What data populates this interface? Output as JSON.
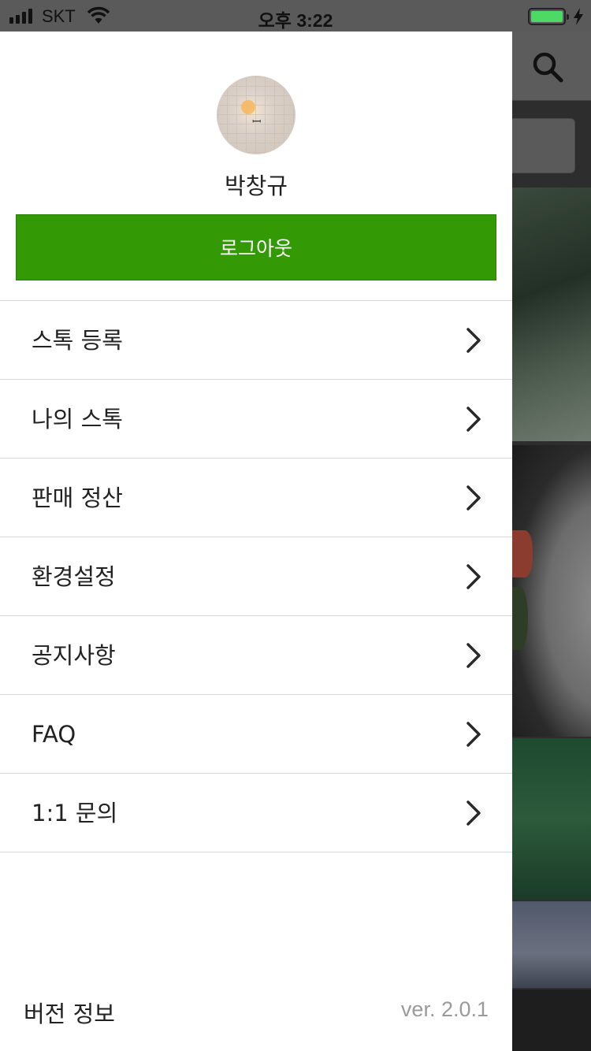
{
  "status_bar": {
    "carrier": "SKT",
    "time": "오후 3:22",
    "battery_level": 1.0,
    "signal_bars": 4,
    "icons": [
      "signal-icon",
      "wifi-icon",
      "battery-icon",
      "charging-bolt-icon"
    ]
  },
  "drawer": {
    "profile": {
      "name": "박창규",
      "avatar_icon": "profile-avatar-image"
    },
    "logout_label": "로그아웃",
    "menu_items": [
      {
        "label": "스톡 등록"
      },
      {
        "label": "나의 스톡"
      },
      {
        "label": "판매 정산"
      },
      {
        "label": "환경설정"
      },
      {
        "label": "공지사항"
      },
      {
        "label": "FAQ"
      },
      {
        "label": "1:1 문의"
      }
    ],
    "version": {
      "label": "버전 정보",
      "value": "ver. 2.0.1"
    }
  },
  "background": {
    "header_icon": "search-icon"
  },
  "colors": {
    "accent": "#339a06",
    "overlay": "#5a5a5a",
    "divider": "#d8d8d8",
    "version_text": "#9a9a9a"
  }
}
